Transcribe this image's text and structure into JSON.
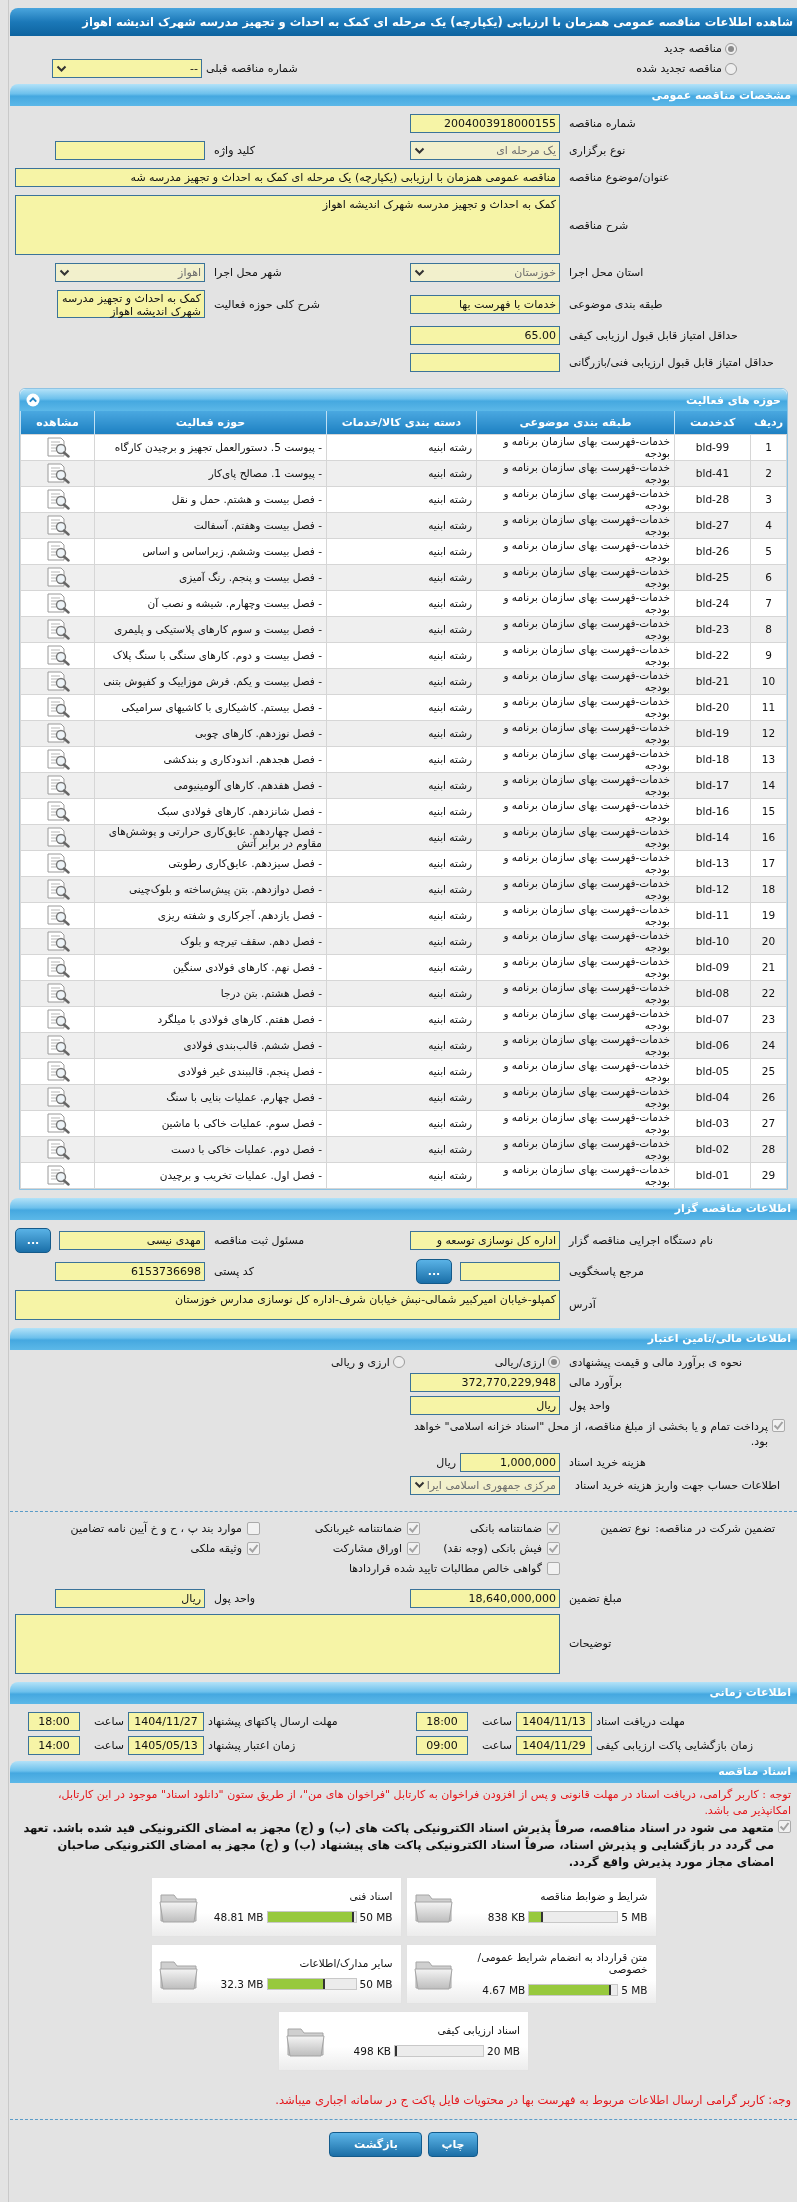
{
  "window": {
    "title": "شاهده اطلاعات مناقصه عمومی همزمان با ارزیابی (یکپارچه) یک مرحله ای کمک به احداث و تجهیز مدرسه شهرک اندیشه اهواز"
  },
  "tender_status": {
    "options": [
      {
        "label": "مناقصه جدید",
        "selected": true
      },
      {
        "label": "مناقصه تجدید شده",
        "selected": false
      }
    ],
    "previous": {
      "label": "شماره مناقصه قبلی",
      "value": "--",
      "kind": "select",
      "disabled": false
    }
  },
  "general": {
    "title": "مشخصات مناقصه عمومی",
    "rows": [
      [
        {
          "label": "شماره مناقصه",
          "value": "2004003918000155",
          "kind": "text"
        }
      ],
      [
        {
          "label": "نوع برگزاری",
          "value": "یک مرحله ای",
          "kind": "select",
          "disabled": true
        },
        {
          "label": "کلید واژه",
          "kind": "text"
        }
      ],
      [
        {
          "label": "عنوان/موضوع مناقصه",
          "value": "مناقصه عمومی همزمان با ارزیابی (یکپارچه) یک مرحله ای کمک به احداث و تجهیز مدرسه شه",
          "kind": "wide"
        }
      ],
      [
        {
          "label": "شرح مناقصه",
          "value": "کمک به احداث و تجهیز مدرسه شهرک اندیشه اهواز",
          "kind": "area"
        }
      ],
      [
        {
          "label": "استان محل اجرا",
          "value": "خوزستان",
          "kind": "select",
          "disabled": true
        },
        {
          "label": "شهر محل اجرا",
          "value": "اهواز",
          "kind": "select",
          "disabled": true
        }
      ],
      [
        {
          "label": "طبقه بندی موضوعی",
          "value": "خدمات با فهرست بها",
          "kind": "text"
        },
        {
          "label": "شرح کلی حوزه فعالیت",
          "value": "کمک به احداث و تجهیز مدرسه شهرک اندیشه اهواز",
          "kind": "small_area"
        }
      ],
      [
        {
          "label": "حداقل امتیاز قابل قبول ارزیابی کیفی",
          "value": "65.00",
          "kind": "text"
        }
      ],
      [
        {
          "label": "حداقل امتیاز قابل قبول ارزیابی فنی/بازرگانی",
          "kind": "text"
        }
      ]
    ]
  },
  "activities": {
    "title": "حوزه های فعالیت",
    "columns": [
      "ردیف",
      "کدخدمت",
      "طبقه بندی موضوعی",
      "دسته بندی کالا/خدمات",
      "حوزه فعالیت",
      "مشاهده"
    ],
    "rows": [
      {
        "row": "1",
        "code": "bld-99",
        "category": "خدمات-فهرست بهای سازمان برنامه و بودجه",
        "group": "رشته ابنیه",
        "activity": "- پیوست 5. دستورالعمل تجهیز و برچیدن کارگاه"
      },
      {
        "row": "2",
        "code": "bld-41",
        "category": "خدمات-فهرست بهای سازمان برنامه و بودجه",
        "group": "رشته ابنیه",
        "activity": "- پیوست 1. مصالح پای‌کار"
      },
      {
        "row": "3",
        "code": "bld-28",
        "category": "خدمات-فهرست بهای سازمان برنامه و بودجه",
        "group": "رشته ابنیه",
        "activity": "- فصل بیست و هشتم. حمل و نقل"
      },
      {
        "row": "4",
        "code": "bld-27",
        "category": "خدمات-فهرست بهای سازمان برنامه و بودجه",
        "group": "رشته ابنیه",
        "activity": "- فصل بیست وهفتم. آسفالت"
      },
      {
        "row": "5",
        "code": "bld-26",
        "category": "خدمات-فهرست بهای سازمان برنامه و بودجه",
        "group": "رشته ابنیه",
        "activity": "- فصل بیست وششم. زیراساس و اساس"
      },
      {
        "row": "6",
        "code": "bld-25",
        "category": "خدمات-فهرست بهای سازمان برنامه و بودجه",
        "group": "رشته ابنیه",
        "activity": "- فصل بیست و پنجم. رنگ آمیزی"
      },
      {
        "row": "7",
        "code": "bld-24",
        "category": "خدمات-فهرست بهای سازمان برنامه و بودجه",
        "group": "رشته ابنیه",
        "activity": "- فصل بیست وچهارم. شیشه و نصب آن"
      },
      {
        "row": "8",
        "code": "bld-23",
        "category": "خدمات-فهرست بهای سازمان برنامه و بودجه",
        "group": "رشته ابنیه",
        "activity": "- فصل بیست و سوم کارهای پلاستیکی و پلیمری"
      },
      {
        "row": "9",
        "code": "bld-22",
        "category": "خدمات-فهرست بهای سازمان برنامه و بودجه",
        "group": "رشته ابنیه",
        "activity": "- فصل بیست و دوم. کارهای سنگی با سنگ پلاک"
      },
      {
        "row": "10",
        "code": "bld-21",
        "category": "خدمات-فهرست بهای سازمان برنامه و بودجه",
        "group": "رشته ابنیه",
        "activity": "- فصل بیست و یکم. فرش موزاییک و کفپوش بتنی"
      },
      {
        "row": "11",
        "code": "bld-20",
        "category": "خدمات-فهرست بهای سازمان برنامه و بودجه",
        "group": "رشته ابنیه",
        "activity": "- فصل بیستم. کاشیکاری با کاشیهای سرامیکی"
      },
      {
        "row": "12",
        "code": "bld-19",
        "category": "خدمات-فهرست بهای سازمان برنامه و بودجه",
        "group": "رشته ابنیه",
        "activity": "- فصل نوزدهم. کارهای چوبی"
      },
      {
        "row": "13",
        "code": "bld-18",
        "category": "خدمات-فهرست بهای سازمان برنامه و بودجه",
        "group": "رشته ابنیه",
        "activity": "- فصل هجدهم. اندودکاری و بندکشی"
      },
      {
        "row": "14",
        "code": "bld-17",
        "category": "خدمات-فهرست بهای سازمان برنامه و بودجه",
        "group": "رشته ابنیه",
        "activity": "- فصل هفدهم. کارهای آلومینیومی"
      },
      {
        "row": "15",
        "code": "bld-16",
        "category": "خدمات-فهرست بهای سازمان برنامه و بودجه",
        "group": "رشته ابنیه",
        "activity": "- فصل شانزدهم. کارهای فولادی سبک"
      },
      {
        "row": "16",
        "code": "bld-14",
        "category": "خدمات-فهرست بهای سازمان برنامه و بودجه",
        "group": "رشته ابنیه",
        "activity": "- فصل چهاردهم. عایق‌کاری حرارتی و پوشش‌های مقاوم در برابر آتش"
      },
      {
        "row": "17",
        "code": "bld-13",
        "category": "خدمات-فهرست بهای سازمان برنامه و بودجه",
        "group": "رشته ابنیه",
        "activity": "- فصل سیزدهم. عایق‌کاری رطوبتی"
      },
      {
        "row": "18",
        "code": "bld-12",
        "category": "خدمات-فهرست بهای سازمان برنامه و بودجه",
        "group": "رشته ابنیه",
        "activity": "- فصل دوازدهم. بتن پیش‌ساخته و بلوک‌چینی"
      },
      {
        "row": "19",
        "code": "bld-11",
        "category": "خدمات-فهرست بهای سازمان برنامه و بودجه",
        "group": "رشته ابنیه",
        "activity": "- فصل یازدهم. آجرکاری و شفته ریزی"
      },
      {
        "row": "20",
        "code": "bld-10",
        "category": "خدمات-فهرست بهای سازمان برنامه و بودجه",
        "group": "رشته ابنیه",
        "activity": "- فصل دهم. سقف تیرچه و بلوک"
      },
      {
        "row": "21",
        "code": "bld-09",
        "category": "خدمات-فهرست بهای سازمان برنامه و بودجه",
        "group": "رشته ابنیه",
        "activity": "- فصل نهم. کارهای فولادی سنگین"
      },
      {
        "row": "22",
        "code": "bld-08",
        "category": "خدمات-فهرست بهای سازمان برنامه و بودجه",
        "group": "رشته ابنیه",
        "activity": "- فصل هشتم. بتن درجا"
      },
      {
        "row": "23",
        "code": "bld-07",
        "category": "خدمات-فهرست بهای سازمان برنامه و بودجه",
        "group": "رشته ابنیه",
        "activity": "- فصل هفتم. کارهای فولادی با میلگرد"
      },
      {
        "row": "24",
        "code": "bld-06",
        "category": "خدمات-فهرست بهای سازمان برنامه و بودجه",
        "group": "رشته ابنیه",
        "activity": "- فصل ششم. قالب‌بندی فولادی"
      },
      {
        "row": "25",
        "code": "bld-05",
        "category": "خدمات-فهرست بهای سازمان برنامه و بودجه",
        "group": "رشته ابنیه",
        "activity": "- فصل پنجم. قالببندی غیر فولادی"
      },
      {
        "row": "26",
        "code": "bld-04",
        "category": "خدمات-فهرست بهای سازمان برنامه و بودجه",
        "group": "رشته ابنیه",
        "activity": "- فصل چهارم. عملیات بنایی با سنگ"
      },
      {
        "row": "27",
        "code": "bld-03",
        "category": "خدمات-فهرست بهای سازمان برنامه و بودجه",
        "group": "رشته ابنیه",
        "activity": "- فصل سوم. عملیات خاکی با ماشین"
      },
      {
        "row": "28",
        "code": "bld-02",
        "category": "خدمات-فهرست بهای سازمان برنامه و بودجه",
        "group": "رشته ابنیه",
        "activity": "- فصل دوم. عملیات خاکی با دست"
      },
      {
        "row": "29",
        "code": "bld-01",
        "category": "خدمات-فهرست بهای سازمان برنامه و بودجه",
        "group": "رشته ابنیه",
        "activity": "- فصل اول. عملیات تخریب و برچیدن"
      }
    ]
  },
  "organizer": {
    "title": "اطلاعات مناقصه گزار",
    "rows": [
      [
        {
          "label": "نام دستگاه اجرایی مناقصه گزار",
          "value": "اداره کل نوسازی  توسعه و",
          "kind": "text"
        },
        {
          "label": "مسئول ثبت مناقصه",
          "value": "مهدی نیسی",
          "kind": "text",
          "button": "..."
        }
      ],
      [
        {
          "label": "مرجع پاسخگویی",
          "kind": "short",
          "button": "..."
        },
        {
          "label": "کد پستی",
          "value": "6153736698",
          "kind": "text"
        }
      ],
      [
        {
          "label": "آدرس",
          "value": "کمپلو-خیابان امیرکبیر شمالی-نبش خیابان شرف-اداره کل نوسازی مدارس خوزستان",
          "kind": "area"
        }
      ]
    ]
  },
  "finance": {
    "title": "اطلاعات مالی/تامین اعتبار",
    "estimate_method": {
      "label": "نحوه ی برآورد مالی و قیمت پیشنهادی",
      "options": [
        {
          "label": "ارزی/ریالی",
          "selected": true
        },
        {
          "label": "ارزی و ریالی",
          "selected": false
        }
      ]
    },
    "estimate": {
      "label": "برآورد مالی",
      "value": "372,770,229,948"
    },
    "currency": {
      "label": "واحد پول",
      "value": "ریال"
    },
    "treasury": {
      "label": "پرداخت تمام و یا بخشی از مبلغ مناقصه، از محل \"اسناد خزانه اسلامی\" خواهد بود.",
      "checked": true
    },
    "document_fee": {
      "label": "هزینه خرید اسناد",
      "value": "1,000,000",
      "unit": "ریال"
    },
    "account": {
      "label": "اطلاعات حساب جهت واریز هزینه خرید اسناد",
      "value": "مرکزی جمهوری اسلامی ایرا",
      "kind": "select",
      "disabled": true
    }
  },
  "guarantee": {
    "label": "تضمین شرکت در مناقصه:",
    "type_label": "نوع تضمین",
    "options": [
      {
        "label": "ضمانتنامه بانکی",
        "checked": true
      },
      {
        "label": "ضمانتنامه غیربانکی",
        "checked": true
      },
      {
        "label": "موارد بند پ ، ح و خ آیین نامه تضامین",
        "checked": false
      },
      {
        "label": "فیش بانکی (وجه نقد)",
        "checked": true
      },
      {
        "label": "اوراق مشارکت",
        "checked": true
      },
      {
        "label": "وثیقه ملکی",
        "checked": true
      },
      {
        "label": "گواهی خالص مطالبات تایید شده قراردادها",
        "checked": false
      }
    ],
    "amount": {
      "label": "مبلغ تضمین",
      "value": "18,640,000,000"
    },
    "currency": {
      "label": "واحد پول",
      "value": "ریال"
    },
    "notes": {
      "label": "توضیحات"
    }
  },
  "schedule": {
    "title": "اطلاعات زمانی",
    "items": [
      {
        "label": "مهلت دریافت اسناد",
        "date": "1404/11/13",
        "time_label": "ساعت",
        "time": "18:00"
      },
      {
        "label": "مهلت ارسال پاکتهای پیشنهاد",
        "date": "1404/11/27",
        "time_label": "ساعت",
        "time": "18:00"
      },
      {
        "label": "زمان بازگشایی پاکت ارزیابی کیفی",
        "date": "1404/11/29",
        "time_label": "ساعت",
        "time": "09:00"
      },
      {
        "label": "زمان اعتبار پیشنهاد",
        "date": "1405/05/13",
        "time_label": "ساعت",
        "time": "14:00"
      }
    ]
  },
  "documents": {
    "title": "اسناد مناقصه",
    "notice": "توجه : کاربر گرامی، دریافت اسناد در مهلت قانونی و پس از افزودن فراخوان به کارتابل \"فراخوان های من\"، از طریق ستون \"دانلود اسناد\" موجود در این کارتابل، امکانپذیر می باشد.",
    "commitment": {
      "text": "متعهد می شود در اسناد مناقصه، صرفاً پذیرش اسناد الکترونیکی پاکت های (ب) و (ج) مجهز به امضای الکترونیکی قید شده باشد. تعهد می گردد در بازگشایی و پذیرش اسناد، صرفاً اسناد الکترونیکی پاکت های پیشنهاد (ب) و (ج) مجهز به امضای الکترونیکی صاحبان امضای مجاز مورد پذیرش واقع گردد.",
      "checked": true
    },
    "files": [
      {
        "title": "شرایط و ضوابط مناقصه",
        "limit": "5 MB",
        "size": "838 KB",
        "level": 0.16
      },
      {
        "title": "اسناد فنی",
        "limit": "50 MB",
        "size": "48.81 MB",
        "level": 0.98
      },
      {
        "title": "متن قرارداد به انضمام شرایط عمومی/خصوصی",
        "limit": "5 MB",
        "size": "4.67 MB",
        "level": 0.93
      },
      {
        "title": "سایر مدارک/اطلاعات",
        "limit": "50 MB",
        "size": "32.3 MB",
        "level": 0.65
      },
      {
        "title": "اسناد ارزیابی کیفی",
        "limit": "20 MB",
        "size": "498 KB",
        "level": 0.02
      }
    ],
    "footer_note": "وجه: کاربر گرامی ارسال اطلاعات مربوط به فهرست بها در محتویات فایل پاکت ج در سامانه اجباری میباشد."
  },
  "buttons": [
    "چاپ",
    "بازگشت"
  ]
}
